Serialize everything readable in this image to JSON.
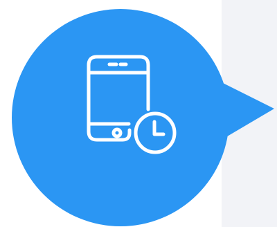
{
  "colors": {
    "background": "#ffffff",
    "panel": "#f2f3f7",
    "bubble": "#2b96f3",
    "icon_stroke": "#ffffff"
  },
  "icon": {
    "name": "phone-clock-icon",
    "parts": [
      "smartphone-icon",
      "clock-icon"
    ]
  }
}
